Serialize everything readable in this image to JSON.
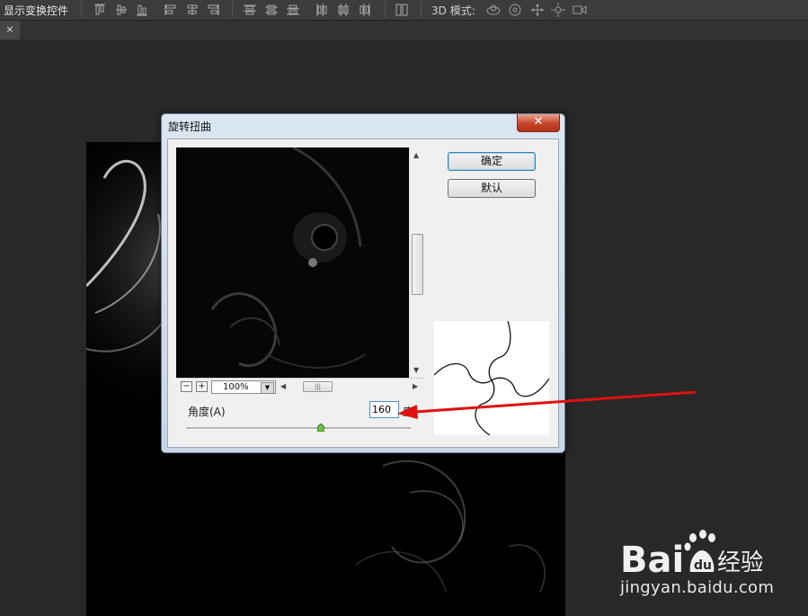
{
  "options_bar": {
    "show_transform_label": "显示变换控件",
    "mode_3d_label": "3D 模式:"
  },
  "doc_tab": {
    "close_glyph": "×"
  },
  "dialog": {
    "title": "旋转扭曲",
    "close_glyph": "✕",
    "ok_label": "确定",
    "default_label": "默认",
    "zoom_value": "100%",
    "zoom_minus": "−",
    "zoom_plus": "+",
    "angle_label": "角度(A)",
    "angle_value": "160",
    "angle_unit": "度",
    "angle_fraction": 0.6
  },
  "watermark": {
    "brand": "Baidu经验",
    "url": "jingyan.baidu.com"
  },
  "colors": {
    "annotation_arrow": "#e01010",
    "ok_focus_border": "#3c7fb1"
  }
}
